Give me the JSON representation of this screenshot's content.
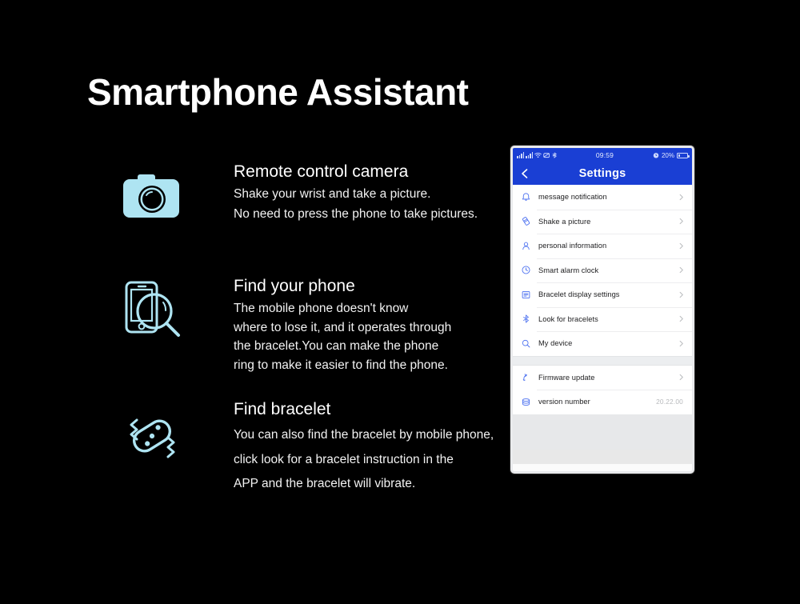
{
  "page": {
    "title": "Smartphone Assistant",
    "background_color": "#000000",
    "accent_color": "#aee4f2"
  },
  "features": [
    {
      "id": "camera",
      "icon": "camera-icon",
      "heading": "Remote control camera",
      "lines": [
        "Shake your wrist and take a picture.",
        "No need to press the phone to take pictures."
      ]
    },
    {
      "id": "findphone",
      "icon": "phone-search-icon",
      "heading": "Find your phone",
      "lines": [
        "The mobile phone doesn't know",
        "where to lose it, and it operates through",
        "the bracelet.You can make the phone",
        "ring to make it easier to find the phone."
      ]
    },
    {
      "id": "bracelet",
      "icon": "bracelet-vibrate-icon",
      "heading": "Find bracelet",
      "lines": [
        "You can also find the bracelet by mobile phone,",
        " click  look for a bracelet instruction in the",
        "APP and the bracelet will vibrate."
      ]
    }
  ],
  "phone": {
    "status_bar": {
      "signal_icon": "signal-bars-icon",
      "wifi_icon": "wifi-icon",
      "time": "09:59",
      "alarm_icon": "alarm-clock-icon",
      "battery_percent": "20%",
      "battery_icon": "battery-icon"
    },
    "nav": {
      "back_icon": "chevron-left-icon",
      "title": "Settings"
    },
    "header_color": "#1a3fd4",
    "groups": [
      {
        "items": [
          {
            "icon": "bell-icon",
            "label": "message notification",
            "accessory": "chevron"
          },
          {
            "icon": "shake-phone-icon",
            "label": "Shake a picture",
            "accessory": "chevron"
          },
          {
            "icon": "person-icon",
            "label": "personal information",
            "accessory": "chevron"
          },
          {
            "icon": "clock-icon",
            "label": "Smart alarm clock",
            "accessory": "chevron"
          },
          {
            "icon": "display-list-icon",
            "label": "Bracelet display settings",
            "accessory": "chevron"
          },
          {
            "icon": "bluetooth-icon",
            "label": "Look for bracelets",
            "accessory": "chevron"
          },
          {
            "icon": "search-icon",
            "label": "My device",
            "accessory": "chevron"
          }
        ]
      },
      {
        "items": [
          {
            "icon": "firmware-update-icon",
            "label": "Firmware update",
            "accessory": "chevron"
          },
          {
            "icon": "database-icon",
            "label": "version number",
            "accessory": "value",
            "value": "20.22.00"
          }
        ]
      }
    ]
  }
}
